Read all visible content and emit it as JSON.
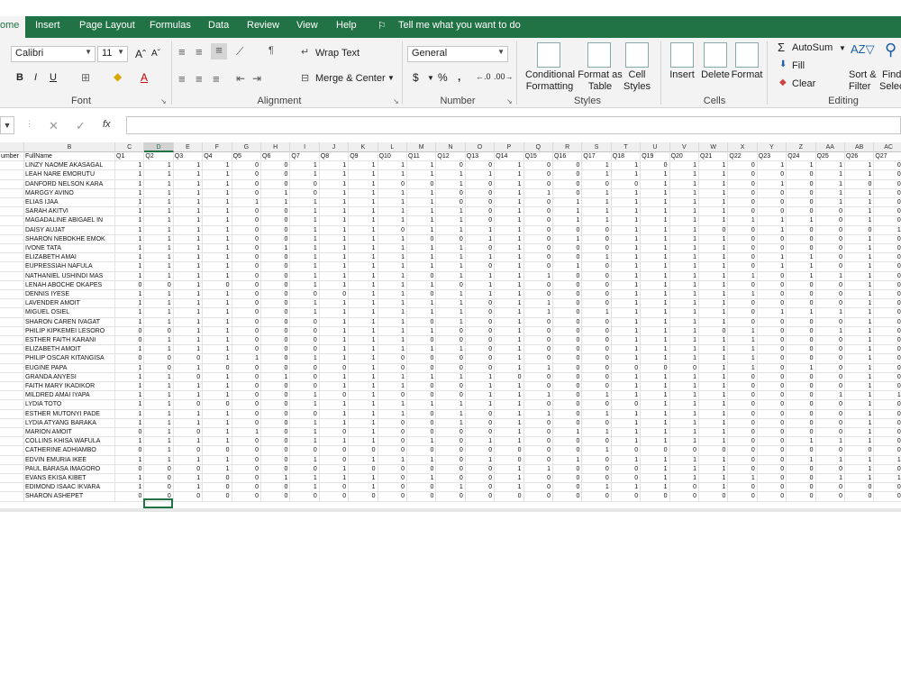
{
  "menu": {
    "home": "ome",
    "insert": "Insert",
    "page_layout": "Page Layout",
    "formulas": "Formulas",
    "data": "Data",
    "review": "Review",
    "view": "View",
    "help": "Help",
    "tell_me": "Tell me what you want to do"
  },
  "font": {
    "name": "Calibri",
    "size": "11",
    "group_label": "Font"
  },
  "alignment": {
    "wrap_text": "Wrap Text",
    "merge_center": "Merge & Center",
    "group_label": "Alignment"
  },
  "number": {
    "format": "General",
    "currency": "$",
    "percent": "%",
    "comma": ",",
    "group_label": "Number"
  },
  "styles": {
    "conditional_line1": "Conditional",
    "conditional_line2": "Formatting",
    "format_table_line1": "Format as",
    "format_table_line2": "Table",
    "cell_styles_line1": "Cell",
    "cell_styles_line2": "Styles",
    "group_label": "Styles"
  },
  "cells": {
    "insert": "Insert",
    "delete": "Delete",
    "format": "Format",
    "group_label": "Cells"
  },
  "editing": {
    "autosum": "AutoSum",
    "fill": "Fill",
    "clear": "Clear",
    "sort_line1": "Sort &",
    "sort_line2": "Filter",
    "find_line1": "Find",
    "find_line2": "Selec",
    "group_label": "Editing"
  },
  "formula_bar": {
    "fx": "fx",
    "cancel": "✕",
    "enter": "✓",
    "value": ""
  },
  "sheet": {
    "col_letters": [
      "",
      "B",
      "C",
      "D",
      "E",
      "F",
      "G",
      "H",
      "I",
      "J",
      "K",
      "L",
      "M",
      "N",
      "O",
      "P",
      "Q",
      "R",
      "S",
      "T",
      "U",
      "V",
      "W",
      "X",
      "Y",
      "Z",
      "AA",
      "AB",
      "AC"
    ],
    "headers": [
      "umber",
      "FullName",
      "Q1",
      "Q2",
      "Q3",
      "Q4",
      "Q5",
      "Q6",
      "Q7",
      "Q8",
      "Q9",
      "Q10",
      "Q11",
      "Q12",
      "Q13",
      "Q14",
      "Q15",
      "Q16",
      "Q17",
      "Q18",
      "Q19",
      "Q20",
      "Q21",
      "Q22",
      "Q23",
      "Q24",
      "Q25",
      "Q26",
      "Q27"
    ],
    "selected_col": "D",
    "rows": [
      [
        "LINZY NAOME AKASAGAL",
        "1",
        "1",
        "1",
        "1",
        "0",
        "0",
        "1",
        "1",
        "1",
        "1",
        "1",
        "0",
        "0",
        "1",
        "0",
        "0",
        "1",
        "1",
        "0",
        "1",
        "1",
        "0",
        "1",
        "1",
        "1",
        "1",
        "0"
      ],
      [
        "LEAH NARE EMORUTU",
        "1",
        "1",
        "1",
        "1",
        "0",
        "0",
        "1",
        "1",
        "1",
        "1",
        "1",
        "1",
        "1",
        "1",
        "0",
        "0",
        "1",
        "1",
        "1",
        "1",
        "1",
        "0",
        "0",
        "0",
        "1",
        "1",
        "0"
      ],
      [
        "DANFORD NELSON KARA",
        "1",
        "1",
        "1",
        "1",
        "0",
        "0",
        "0",
        "1",
        "1",
        "0",
        "0",
        "1",
        "0",
        "1",
        "0",
        "0",
        "0",
        "0",
        "1",
        "1",
        "1",
        "0",
        "1",
        "0",
        "1",
        "0",
        "0"
      ],
      [
        "MARGGY AVINO",
        "1",
        "1",
        "1",
        "1",
        "0",
        "1",
        "0",
        "1",
        "1",
        "1",
        "1",
        "0",
        "0",
        "1",
        "1",
        "0",
        "1",
        "1",
        "1",
        "1",
        "1",
        "0",
        "0",
        "0",
        "1",
        "1",
        "0"
      ],
      [
        "ELIAS IJAA",
        "1",
        "1",
        "1",
        "1",
        "1",
        "1",
        "1",
        "1",
        "1",
        "1",
        "1",
        "0",
        "0",
        "1",
        "0",
        "1",
        "1",
        "1",
        "1",
        "1",
        "1",
        "0",
        "0",
        "0",
        "1",
        "1",
        "0"
      ],
      [
        "SARAH AKITVI",
        "1",
        "1",
        "1",
        "1",
        "0",
        "0",
        "1",
        "1",
        "1",
        "1",
        "1",
        "1",
        "0",
        "1",
        "0",
        "1",
        "1",
        "1",
        "1",
        "1",
        "1",
        "0",
        "0",
        "0",
        "0",
        "1",
        "0"
      ],
      [
        "MAGADALINE ABIGAEL IN",
        "1",
        "1",
        "1",
        "1",
        "0",
        "0",
        "1",
        "1",
        "1",
        "1",
        "1",
        "1",
        "0",
        "1",
        "0",
        "1",
        "1",
        "1",
        "1",
        "1",
        "1",
        "1",
        "1",
        "1",
        "0",
        "1",
        "0"
      ],
      [
        "DAISY AUJAT",
        "1",
        "1",
        "1",
        "1",
        "0",
        "0",
        "1",
        "1",
        "1",
        "0",
        "1",
        "1",
        "1",
        "1",
        "0",
        "0",
        "0",
        "1",
        "1",
        "1",
        "0",
        "0",
        "1",
        "0",
        "0",
        "0",
        "1"
      ],
      [
        "SHARON NEBOKHE EMOK",
        "1",
        "1",
        "1",
        "1",
        "0",
        "0",
        "1",
        "1",
        "1",
        "1",
        "0",
        "0",
        "1",
        "1",
        "0",
        "1",
        "0",
        "1",
        "1",
        "1",
        "1",
        "0",
        "0",
        "0",
        "0",
        "1",
        "0"
      ],
      [
        "IVONE TATA",
        "1",
        "1",
        "1",
        "1",
        "0",
        "1",
        "1",
        "1",
        "1",
        "1",
        "1",
        "1",
        "0",
        "1",
        "0",
        "0",
        "0",
        "1",
        "1",
        "1",
        "1",
        "0",
        "0",
        "0",
        "0",
        "1",
        "0"
      ],
      [
        "ELIZABETH AMAI",
        "1",
        "1",
        "1",
        "1",
        "0",
        "0",
        "1",
        "1",
        "1",
        "1",
        "1",
        "1",
        "1",
        "1",
        "0",
        "0",
        "1",
        "1",
        "1",
        "1",
        "1",
        "0",
        "1",
        "1",
        "0",
        "1",
        "0"
      ],
      [
        "EUPRESSIAH NAFULA",
        "1",
        "1",
        "1",
        "1",
        "0",
        "0",
        "1",
        "1",
        "1",
        "1",
        "1",
        "1",
        "0",
        "1",
        "0",
        "1",
        "0",
        "1",
        "1",
        "1",
        "1",
        "0",
        "1",
        "1",
        "0",
        "1",
        "0"
      ],
      [
        "NATHANIEL USHINDI MAS",
        "1",
        "1",
        "1",
        "1",
        "0",
        "0",
        "1",
        "1",
        "1",
        "1",
        "0",
        "1",
        "1",
        "1",
        "1",
        "0",
        "0",
        "1",
        "1",
        "1",
        "1",
        "1",
        "0",
        "1",
        "1",
        "1",
        "0"
      ],
      [
        "LENAH ABOCHE OKAPES",
        "0",
        "0",
        "1",
        "0",
        "0",
        "0",
        "1",
        "1",
        "1",
        "1",
        "1",
        "0",
        "1",
        "1",
        "0",
        "0",
        "0",
        "1",
        "1",
        "1",
        "1",
        "0",
        "0",
        "0",
        "0",
        "1",
        "0"
      ],
      [
        "DENNIS IYESE",
        "1",
        "1",
        "1",
        "1",
        "0",
        "0",
        "0",
        "0",
        "1",
        "1",
        "0",
        "1",
        "1",
        "1",
        "0",
        "0",
        "0",
        "1",
        "1",
        "1",
        "1",
        "1",
        "0",
        "0",
        "0",
        "1",
        "0"
      ],
      [
        "LAVENDER AMOIT",
        "1",
        "1",
        "1",
        "1",
        "0",
        "0",
        "1",
        "1",
        "1",
        "1",
        "1",
        "1",
        "0",
        "1",
        "1",
        "0",
        "0",
        "1",
        "1",
        "1",
        "1",
        "0",
        "0",
        "0",
        "0",
        "1",
        "0"
      ],
      [
        "MIGUEL OSIEL",
        "1",
        "1",
        "1",
        "1",
        "0",
        "0",
        "1",
        "1",
        "1",
        "1",
        "1",
        "1",
        "0",
        "1",
        "1",
        "0",
        "1",
        "1",
        "1",
        "1",
        "1",
        "0",
        "1",
        "1",
        "1",
        "1",
        "0"
      ],
      [
        "SHARON CAREN IVAGAT",
        "1",
        "1",
        "1",
        "1",
        "0",
        "0",
        "0",
        "1",
        "1",
        "1",
        "0",
        "1",
        "0",
        "1",
        "0",
        "0",
        "0",
        "1",
        "1",
        "1",
        "1",
        "0",
        "0",
        "0",
        "0",
        "1",
        "0"
      ],
      [
        "PHILIP KIPKEMEI LESORO",
        "0",
        "0",
        "1",
        "1",
        "0",
        "0",
        "0",
        "1",
        "1",
        "1",
        "1",
        "0",
        "0",
        "1",
        "0",
        "0",
        "0",
        "1",
        "1",
        "1",
        "0",
        "1",
        "0",
        "0",
        "1",
        "1",
        "0"
      ],
      [
        "ESTHER FAITH KARANI",
        "0",
        "1",
        "1",
        "1",
        "0",
        "0",
        "0",
        "1",
        "1",
        "1",
        "0",
        "0",
        "0",
        "1",
        "0",
        "0",
        "0",
        "1",
        "1",
        "1",
        "1",
        "1",
        "0",
        "0",
        "0",
        "1",
        "0"
      ],
      [
        "ELIZABETH AMOIT",
        "1",
        "1",
        "1",
        "1",
        "0",
        "0",
        "0",
        "1",
        "1",
        "1",
        "1",
        "1",
        "0",
        "1",
        "0",
        "0",
        "0",
        "1",
        "1",
        "1",
        "1",
        "1",
        "0",
        "0",
        "0",
        "1",
        "0"
      ],
      [
        "PHILIP OSCAR KITANGISA",
        "0",
        "0",
        "0",
        "1",
        "1",
        "0",
        "1",
        "1",
        "1",
        "0",
        "0",
        "0",
        "0",
        "1",
        "0",
        "0",
        "0",
        "1",
        "1",
        "1",
        "1",
        "1",
        "0",
        "0",
        "0",
        "1",
        "0"
      ],
      [
        "EUGINE PAPA",
        "1",
        "0",
        "1",
        "0",
        "0",
        "0",
        "0",
        "0",
        "1",
        "0",
        "0",
        "0",
        "0",
        "1",
        "1",
        "0",
        "0",
        "0",
        "0",
        "0",
        "1",
        "1",
        "0",
        "1",
        "0",
        "1",
        "0"
      ],
      [
        "GRANDA ANYESI",
        "1",
        "1",
        "0",
        "1",
        "0",
        "1",
        "0",
        "1",
        "1",
        "1",
        "1",
        "1",
        "1",
        "0",
        "0",
        "0",
        "0",
        "1",
        "1",
        "1",
        "1",
        "0",
        "0",
        "0",
        "0",
        "1",
        "0"
      ],
      [
        "FAITH MARY IKADIKOR",
        "1",
        "1",
        "1",
        "1",
        "0",
        "0",
        "0",
        "1",
        "1",
        "1",
        "0",
        "0",
        "1",
        "1",
        "0",
        "0",
        "0",
        "1",
        "1",
        "1",
        "1",
        "0",
        "0",
        "0",
        "0",
        "1",
        "0"
      ],
      [
        "MILDRED AMAI IYAPA",
        "1",
        "1",
        "1",
        "1",
        "0",
        "0",
        "1",
        "0",
        "1",
        "0",
        "0",
        "0",
        "1",
        "1",
        "1",
        "0",
        "1",
        "1",
        "1",
        "1",
        "1",
        "0",
        "0",
        "0",
        "1",
        "1",
        "1"
      ],
      [
        "LYDIA TOTO",
        "1",
        "1",
        "0",
        "0",
        "0",
        "0",
        "1",
        "1",
        "1",
        "1",
        "1",
        "1",
        "1",
        "1",
        "0",
        "0",
        "0",
        "0",
        "1",
        "1",
        "1",
        "0",
        "0",
        "0",
        "0",
        "1",
        "0"
      ],
      [
        "ESTHER MUTONYI PADE",
        "1",
        "1",
        "1",
        "1",
        "0",
        "0",
        "0",
        "1",
        "1",
        "1",
        "0",
        "1",
        "0",
        "1",
        "1",
        "0",
        "1",
        "1",
        "1",
        "1",
        "1",
        "0",
        "0",
        "0",
        "0",
        "1",
        "0"
      ],
      [
        "LYDIA ATYANG BARAKA",
        "1",
        "1",
        "1",
        "1",
        "0",
        "0",
        "1",
        "1",
        "1",
        "0",
        "0",
        "1",
        "0",
        "1",
        "0",
        "0",
        "0",
        "1",
        "1",
        "1",
        "1",
        "0",
        "0",
        "0",
        "0",
        "1",
        "0"
      ],
      [
        "MARION AMOIT",
        "0",
        "1",
        "0",
        "1",
        "1",
        "0",
        "1",
        "0",
        "1",
        "0",
        "0",
        "0",
        "0",
        "1",
        "0",
        "1",
        "1",
        "1",
        "1",
        "1",
        "1",
        "0",
        "0",
        "0",
        "0",
        "1",
        "0"
      ],
      [
        "COLLINS KHISA WAFULA",
        "1",
        "1",
        "1",
        "1",
        "0",
        "0",
        "1",
        "1",
        "1",
        "0",
        "1",
        "0",
        "1",
        "1",
        "0",
        "0",
        "0",
        "1",
        "1",
        "1",
        "1",
        "0",
        "0",
        "1",
        "1",
        "1",
        "0"
      ],
      [
        "CATHERINE ADHIAMBO",
        "0",
        "1",
        "0",
        "0",
        "0",
        "0",
        "0",
        "0",
        "0",
        "0",
        "0",
        "0",
        "0",
        "0",
        "0",
        "0",
        "1",
        "0",
        "0",
        "0",
        "0",
        "0",
        "0",
        "0",
        "0",
        "0",
        "0"
      ],
      [
        "EDVIN EMURIA IKEE",
        "1",
        "1",
        "1",
        "1",
        "0",
        "0",
        "1",
        "0",
        "1",
        "1",
        "1",
        "0",
        "1",
        "0",
        "0",
        "1",
        "0",
        "1",
        "1",
        "1",
        "1",
        "0",
        "0",
        "1",
        "1",
        "1",
        "1"
      ],
      [
        "PAUL BARASA IMAGORO",
        "0",
        "0",
        "0",
        "1",
        "0",
        "0",
        "0",
        "1",
        "0",
        "0",
        "0",
        "0",
        "0",
        "1",
        "1",
        "0",
        "0",
        "0",
        "1",
        "1",
        "1",
        "0",
        "0",
        "0",
        "0",
        "1",
        "0"
      ],
      [
        "EVANS EKISA KIBET",
        "1",
        "0",
        "1",
        "0",
        "0",
        "1",
        "1",
        "1",
        "1",
        "0",
        "1",
        "0",
        "0",
        "1",
        "0",
        "0",
        "0",
        "0",
        "1",
        "1",
        "1",
        "1",
        "0",
        "0",
        "1",
        "1",
        "1"
      ],
      [
        "EDIMOND ISAAC IKVARA",
        "1",
        "0",
        "1",
        "0",
        "0",
        "0",
        "1",
        "0",
        "1",
        "0",
        "0",
        "1",
        "0",
        "1",
        "0",
        "0",
        "1",
        "1",
        "1",
        "0",
        "1",
        "0",
        "0",
        "0",
        "0",
        "0",
        "0"
      ],
      [
        "SHARON ASHEPET",
        "0",
        "0",
        "0",
        "0",
        "0",
        "0",
        "0",
        "0",
        "0",
        "0",
        "0",
        "0",
        "0",
        "0",
        "0",
        "0",
        "0",
        "0",
        "0",
        "0",
        "0",
        "0",
        "0",
        "0",
        "0",
        "0",
        "0"
      ]
    ]
  }
}
